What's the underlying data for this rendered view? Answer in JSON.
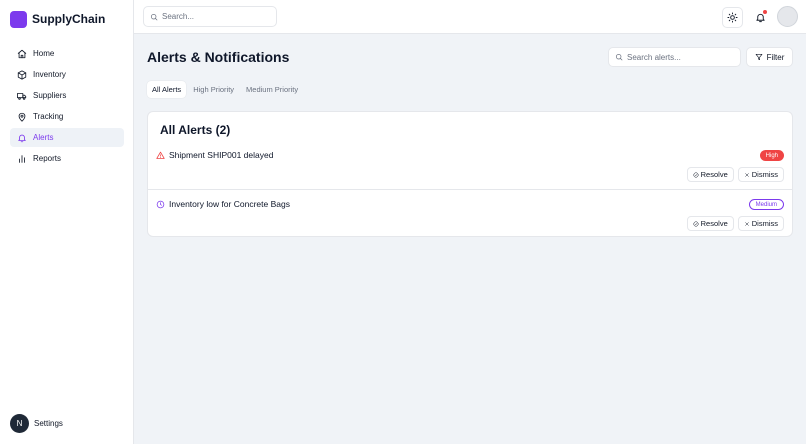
{
  "brand": {
    "name": "SupplyChain",
    "color": "#7c3aed"
  },
  "sidebar": {
    "items": [
      {
        "label": "Home",
        "icon": "home-icon",
        "active": false
      },
      {
        "label": "Inventory",
        "icon": "package-icon",
        "active": false
      },
      {
        "label": "Suppliers",
        "icon": "truck-icon",
        "active": false
      },
      {
        "label": "Tracking",
        "icon": "map-pin-icon",
        "active": false
      },
      {
        "label": "Alerts",
        "icon": "bell-icon",
        "active": true
      },
      {
        "label": "Reports",
        "icon": "bar-chart-icon",
        "active": false
      }
    ],
    "settings": {
      "avatar_letter": "N",
      "label": "Settings"
    }
  },
  "topbar": {
    "search_placeholder": "Search...",
    "theme_icon": "sun-icon",
    "notification_icon": "bell-icon",
    "has_notification_dot": true
  },
  "page": {
    "title": "Alerts & Notifications",
    "search_placeholder": "Search alerts...",
    "filter_label": "Filter",
    "tabs": [
      {
        "label": "All Alerts",
        "active": true
      },
      {
        "label": "High Priority",
        "active": false
      },
      {
        "label": "Medium Priority",
        "active": false
      }
    ]
  },
  "alerts_card": {
    "title": "All Alerts (2)",
    "alerts": [
      {
        "message": "Shipment SHIP001 delayed",
        "icon": "alert-triangle-icon",
        "icon_color": "#ef4444",
        "priority": "High",
        "resolve_label": "Resolve",
        "dismiss_label": "Dismiss"
      },
      {
        "message": "Inventory low for Concrete Bags",
        "icon": "clock-icon",
        "icon_color": "#7c3aed",
        "priority": "Medium",
        "resolve_label": "Resolve",
        "dismiss_label": "Dismiss"
      }
    ]
  }
}
